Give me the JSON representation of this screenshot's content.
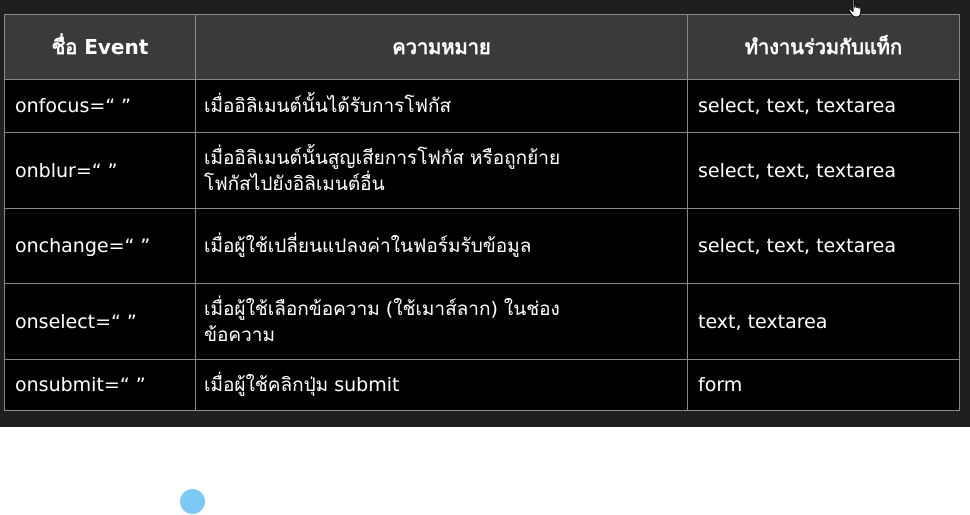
{
  "table": {
    "headers": [
      "ชื่อ Event",
      "ความหมาย",
      "ทำงานร่วมกับแท็ก"
    ],
    "rows": [
      {
        "event": "onfocus=“ ”",
        "meaning": "เมื่ออิลิเมนต์นั้นได้รับการโฟกัส",
        "tags": "select, text, textarea"
      },
      {
        "event": "onblur=“ ”",
        "meaning_line1": "เมื่ออิลิเมนต์นั้นสูญเสียการโฟกัส หรือถูกย้าย",
        "meaning_line2": "โฟกัสไปยังอิลิเมนต์อื่น",
        "tags": "select, text, textarea"
      },
      {
        "event": "onchange=“ ”",
        "meaning": "เมื่อผู้ใช้เปลี่ยนแปลงค่าในฟอร์มรับข้อมูล",
        "tags": "select, text, textarea"
      },
      {
        "event": "onselect=“ ”",
        "meaning_line1": "เมื่อผู้ใช้เลือกข้อความ (ใช้เมาส์ลาก) ในช่อง",
        "meaning_line2": "ข้อความ",
        "tags": "text, textarea"
      },
      {
        "event": "onsubmit=“ ”",
        "meaning": "เมื่อผู้ใช้คลิกปุ่ม submit",
        "tags": "form"
      }
    ]
  },
  "icons": {
    "cursor": "hand-cursor-icon",
    "dot": "blue-dot-icon"
  },
  "colors": {
    "screen_background": "#1f1f1f",
    "header_background": "#3a3a3a",
    "cell_background": "#000000",
    "grid_line": "#8a8a8a",
    "text": "#ffffff",
    "dot": "#7cc8f6"
  }
}
